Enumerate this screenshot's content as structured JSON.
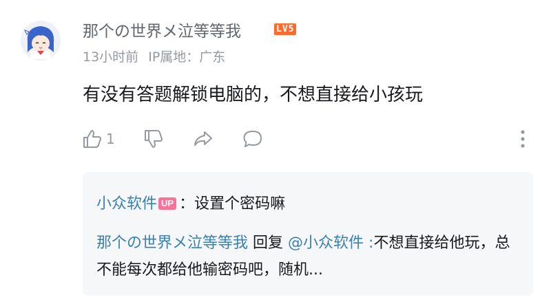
{
  "comment": {
    "username": "那个の世界メ泣等等我",
    "level_badge": "LV5",
    "time": "13小时前",
    "location": "IP属地：广东",
    "content": "有没有答题解锁电脑的，不想直接给小孩玩",
    "like_count": "1",
    "icons": [
      "avatar",
      "like-icon",
      "dislike-icon",
      "share-icon",
      "reply-icon",
      "more-icon"
    ]
  },
  "replies": [
    {
      "user": "小众软件",
      "badge": "UP",
      "separator": "：",
      "text": "设置个密码嘛"
    },
    {
      "user": "那个の世界メ泣等等我",
      "action": " 回复 ",
      "mention": "@小众软件",
      "separator": " :",
      "text": "不想直接给他玩，总不能每次都给他输密码吧，随机..."
    }
  ],
  "colors": {
    "link": "#3a7fb1",
    "level_badge": "#ff6b2c",
    "up_badge": "#fb7299",
    "meta": "#9499a0",
    "reply_bg": "#f6f7f8"
  }
}
